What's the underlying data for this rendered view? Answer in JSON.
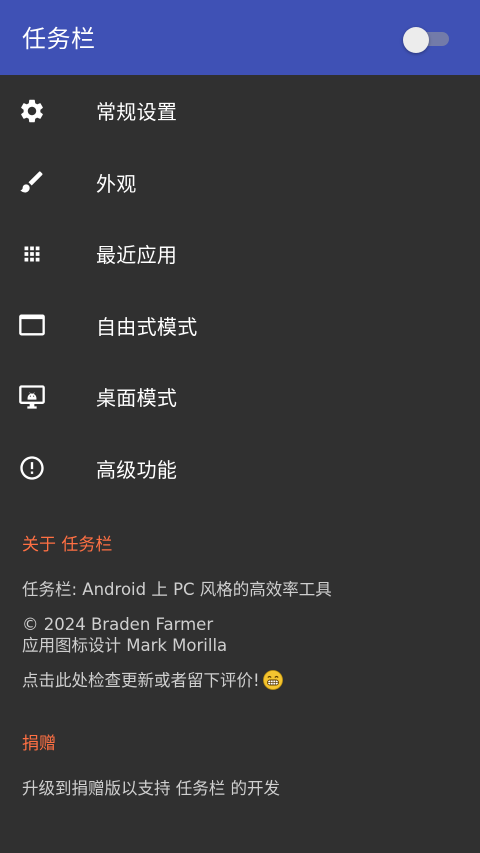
{
  "appbar": {
    "title": "任务栏",
    "toggle_on": false
  },
  "menu": {
    "items": [
      {
        "label": "常规设置",
        "icon": "gear-icon"
      },
      {
        "label": "外观",
        "icon": "brush-icon"
      },
      {
        "label": "最近应用",
        "icon": "grid-icon"
      },
      {
        "label": "自由式模式",
        "icon": "window-icon"
      },
      {
        "label": "桌面模式",
        "icon": "desktop-android-icon"
      },
      {
        "label": "高级功能",
        "icon": "alert-circle-icon"
      }
    ]
  },
  "about": {
    "header": "关于 任务栏",
    "description": "任务栏: Android 上 PC 风格的高效率工具",
    "copyright": "© 2024 Braden Farmer",
    "icon_credit": "应用图标设计 Mark Morilla",
    "update_link": "点击此处检查更新或者留下评价!",
    "update_emoji": "grin-emoji-icon"
  },
  "donate": {
    "header": "捐赠",
    "text": "升级到捐赠版以支持 任务栏 的开发"
  },
  "colors": {
    "appbar": "#3f51b5",
    "background": "#303030",
    "section_header": "#ff7043",
    "primary_text": "#ffffff",
    "secondary_text": "#cfcfcf"
  }
}
